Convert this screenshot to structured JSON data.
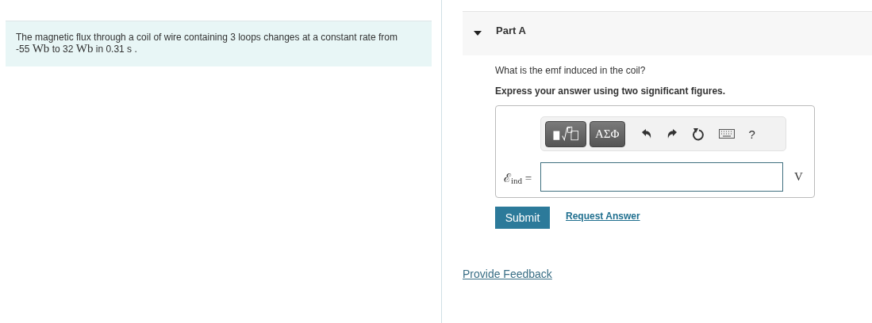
{
  "problem": {
    "segments": [
      {
        "kind": "text",
        "text": "The magnetic flux through a coil of wire containing 3 loops changes at a constant rate from -55 "
      },
      {
        "kind": "unit",
        "text": "Wb"
      },
      {
        "kind": "text",
        "text": " to 32 "
      },
      {
        "kind": "unit",
        "text": "Wb"
      },
      {
        "kind": "text",
        "text": " in 0.31 s ."
      }
    ]
  },
  "part": {
    "title": "Part A",
    "expanded": true,
    "question": "What is the emf induced in the coil?",
    "instruction": "Express your answer using two significant figures.",
    "toolbar": [
      {
        "kind": "templates"
      },
      {
        "kind": "symbols",
        "label": "ΑΣΦ"
      },
      {
        "kind": "undo"
      },
      {
        "kind": "redo"
      },
      {
        "kind": "reset"
      },
      {
        "kind": "keyboard"
      },
      {
        "kind": "help",
        "label": "?"
      }
    ],
    "answer_label": "ℰ$_{ind}$ =",
    "unit": "V",
    "submit": "Submit",
    "request": "Request Answer"
  },
  "feedback": "Provide Feedback"
}
